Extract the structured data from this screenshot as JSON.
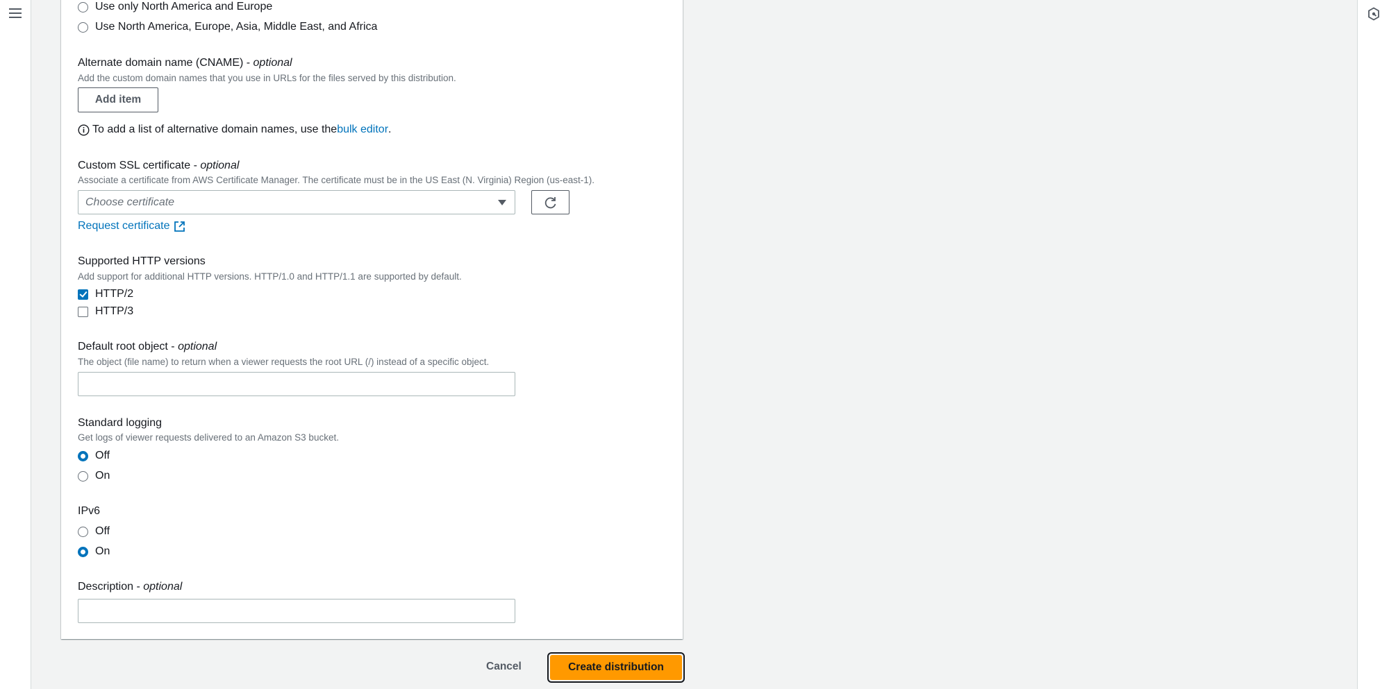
{
  "nav": {
    "menu_icon": "hamburger-menu-icon",
    "rail_icon": "feedback-hexagon-icon"
  },
  "price_class": {
    "options": [
      {
        "label": "Use only North America and Europe",
        "selected": false
      },
      {
        "label": "Use North America, Europe, Asia, Middle East, and Africa",
        "selected": false
      }
    ]
  },
  "cname": {
    "label": "Alternate domain name (CNAME) - ",
    "optional": "optional",
    "description": "Add the custom domain names that you use in URLs for the files served by this distribution.",
    "add_item": "Add item",
    "info_prefix": "To add a list of alternative domain names, use the ",
    "info_link": "bulk editor",
    "info_suffix": "."
  },
  "ssl": {
    "label": "Custom SSL certificate - ",
    "optional": "optional",
    "description": "Associate a certificate from AWS Certificate Manager. The certificate must be in the US East (N. Virginia) Region (us-east-1).",
    "select_placeholder": "Choose certificate",
    "request_link": "Request certificate"
  },
  "http_versions": {
    "label": "Supported HTTP versions",
    "description": "Add support for additional HTTP versions. HTTP/1.0 and HTTP/1.1 are supported by default.",
    "options": [
      {
        "label": "HTTP/2",
        "checked": true
      },
      {
        "label": "HTTP/3",
        "checked": false
      }
    ]
  },
  "root_object": {
    "label": "Default root object - ",
    "optional": "optional",
    "description": "The object (file name) to return when a viewer requests the root URL (/) instead of a specific object.",
    "value": ""
  },
  "logging": {
    "label": "Standard logging",
    "description": "Get logs of viewer requests delivered to an Amazon S3 bucket.",
    "options": [
      {
        "label": "Off",
        "selected": true
      },
      {
        "label": "On",
        "selected": false
      }
    ]
  },
  "ipv6": {
    "label": "IPv6",
    "options": [
      {
        "label": "Off",
        "selected": false
      },
      {
        "label": "On",
        "selected": true
      }
    ]
  },
  "description_field": {
    "label": "Description - ",
    "optional": "optional",
    "value": ""
  },
  "footer": {
    "cancel": "Cancel",
    "create": "Create distribution"
  },
  "colors": {
    "primary": "#ff9900",
    "link": "#0073bb",
    "selected": "#0073bb"
  }
}
